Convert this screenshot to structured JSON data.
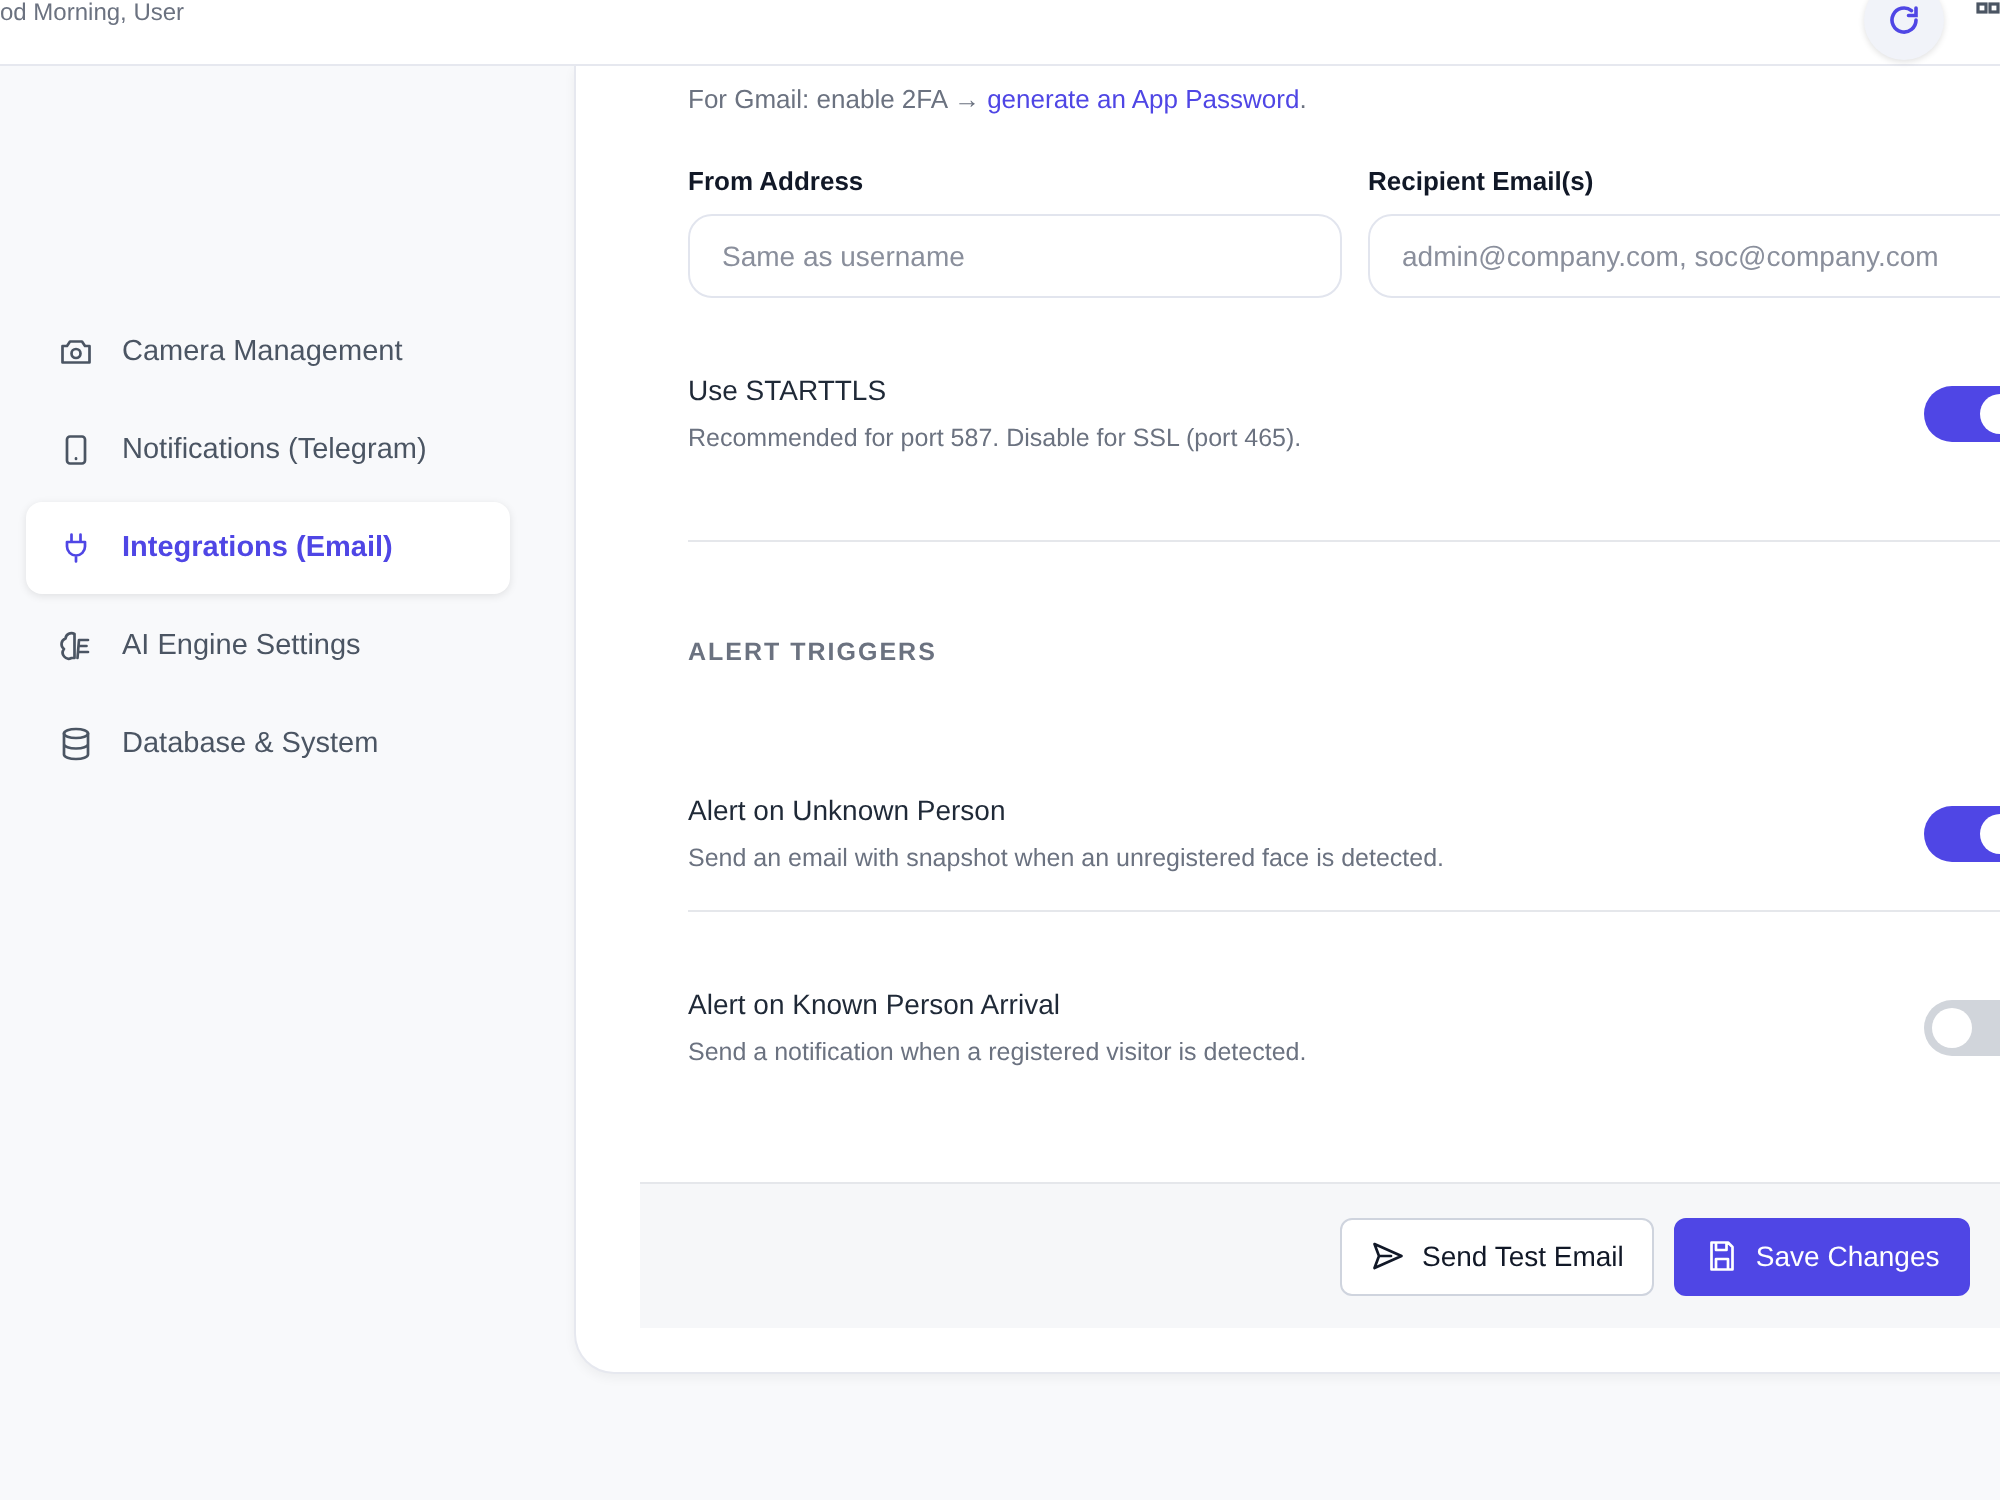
{
  "header": {
    "greeting": "od Morning, User"
  },
  "sidebar": {
    "items": [
      {
        "label": "Camera Management",
        "selected": false
      },
      {
        "label": "Notifications (Telegram)",
        "selected": false
      },
      {
        "label": "Integrations (Email)",
        "selected": true
      },
      {
        "label": "AI Engine Settings",
        "selected": false
      },
      {
        "label": "Database & System",
        "selected": false
      }
    ]
  },
  "email": {
    "hint": "For Gmail: enable 2FA → ",
    "hint_link": "generate an App Password",
    "hint_end": ".",
    "fields": [
      {
        "label": "From Address",
        "placeholder": "Same as username"
      },
      {
        "label": "Recipient Email(s)",
        "placeholder": "admin@company.com, soc@company.com"
      }
    ],
    "starttls": {
      "title": "Use STARTTLS",
      "description": "Recommended for port 587. Disable for SSL (port 465).",
      "on": true
    }
  },
  "alert_triggers": {
    "heading": "ALERT TRIGGERS",
    "items": [
      {
        "title": "Alert on Unknown Person",
        "description": "Send an email with snapshot when an unregistered face is detected.",
        "on": true
      },
      {
        "title": "Alert on Known Person Arrival",
        "description": "Send a notification when a registered visitor is detected.",
        "on": false
      }
    ]
  },
  "footer": {
    "buttons": [
      {
        "label": "Send Test Email",
        "kind": "secondary"
      },
      {
        "label": "Save Changes",
        "kind": "primary"
      }
    ]
  }
}
